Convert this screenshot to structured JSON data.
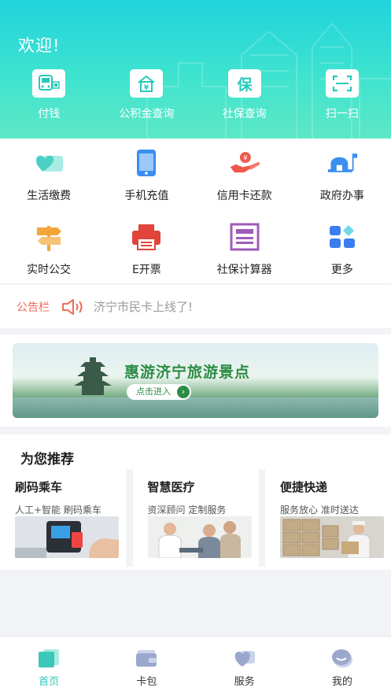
{
  "header": {
    "welcome": "欢迎!",
    "items": [
      {
        "label": "付钱",
        "icon": "bus-qr-icon"
      },
      {
        "label": "公积金查询",
        "icon": "fund-house-icon"
      },
      {
        "label": "社保查询",
        "icon": "social-security-icon"
      },
      {
        "label": "扫一扫",
        "icon": "scan-icon"
      }
    ]
  },
  "services": [
    {
      "label": "生活缴费",
      "icon": "heart-card-icon",
      "color": "#4cd0c6"
    },
    {
      "label": "手机充值",
      "icon": "phone-icon",
      "color": "#3a8ef0"
    },
    {
      "label": "信用卡还款",
      "icon": "coin-hand-icon",
      "color": "#f0584a"
    },
    {
      "label": "政府办事",
      "icon": "government-icon",
      "color": "#3a8ef0"
    },
    {
      "label": "实时公交",
      "icon": "signpost-icon",
      "color": "#f2a63a"
    },
    {
      "label": "E开票",
      "icon": "printer-icon",
      "color": "#e0443a"
    },
    {
      "label": "社保计算器",
      "icon": "calculator-icon",
      "color": "#a05bb8"
    },
    {
      "label": "更多",
      "icon": "more-grid-icon",
      "color": "#3a7ef0"
    }
  ],
  "notice": {
    "tag": "公告栏",
    "text": "济宁市民卡上线了!"
  },
  "banner": {
    "title": "惠游济宁旅游景点",
    "button": "点击进入",
    "arrow": "›"
  },
  "recommend": {
    "title": "为您推荐",
    "cards": [
      {
        "title": "刷码乘车",
        "subtitle": "人工+智能 刷码乘车"
      },
      {
        "title": "智慧医疗",
        "subtitle": "资深顾问 定制服务"
      },
      {
        "title": "便捷快递",
        "subtitle": "服务放心 准时送达"
      }
    ]
  },
  "tabbar": {
    "items": [
      {
        "label": "首页",
        "active": true
      },
      {
        "label": "卡包",
        "active": false
      },
      {
        "label": "服务",
        "active": false
      },
      {
        "label": "我的",
        "active": false
      }
    ]
  },
  "colors": {
    "accent": "#2fc5b5",
    "notice_tag": "#ef6b5b",
    "header_top": "#1fd3dd",
    "header_bottom": "#5de8c6"
  }
}
